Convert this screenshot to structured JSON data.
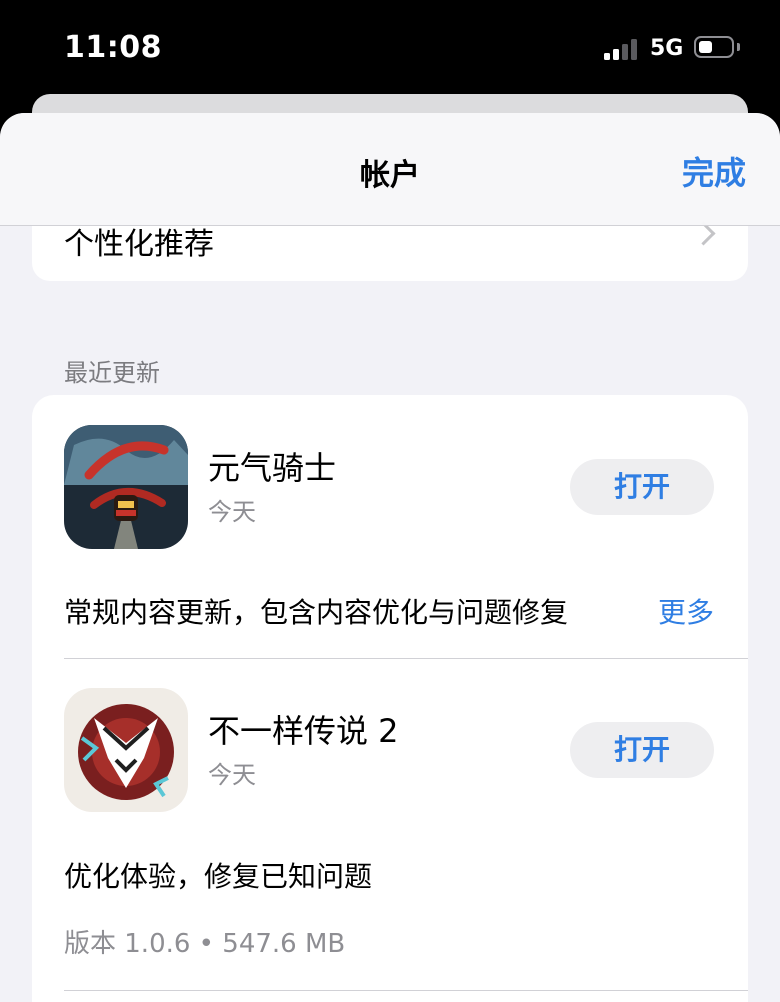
{
  "status_bar": {
    "time": "11:08",
    "network": "5G",
    "signal_bars_active": 2,
    "signal_bars_total": 4,
    "battery_level_fraction": 0.35
  },
  "nav": {
    "title": "帐户",
    "done_label": "完成"
  },
  "top_card": {
    "label": "个性化推荐"
  },
  "section": {
    "header": "最近更新"
  },
  "updates": [
    {
      "name": "元气骑士",
      "date": "今天",
      "button_label": "打开",
      "notes": "常规内容更新，包含内容优化与问题修复",
      "more_label": "更多",
      "icon": "soul-knight-icon"
    },
    {
      "name": "不一样传说 2",
      "date": "今天",
      "button_label": "打开",
      "notes": "优化体验，修复已知问题",
      "version_info": "版本 1.0.6 • 547.6 MB",
      "icon": "another-legend-icon"
    }
  ],
  "colors": {
    "accent": "#2f7ee3",
    "background": "#f2f2f7",
    "secondary_text": "#8e8e93"
  }
}
